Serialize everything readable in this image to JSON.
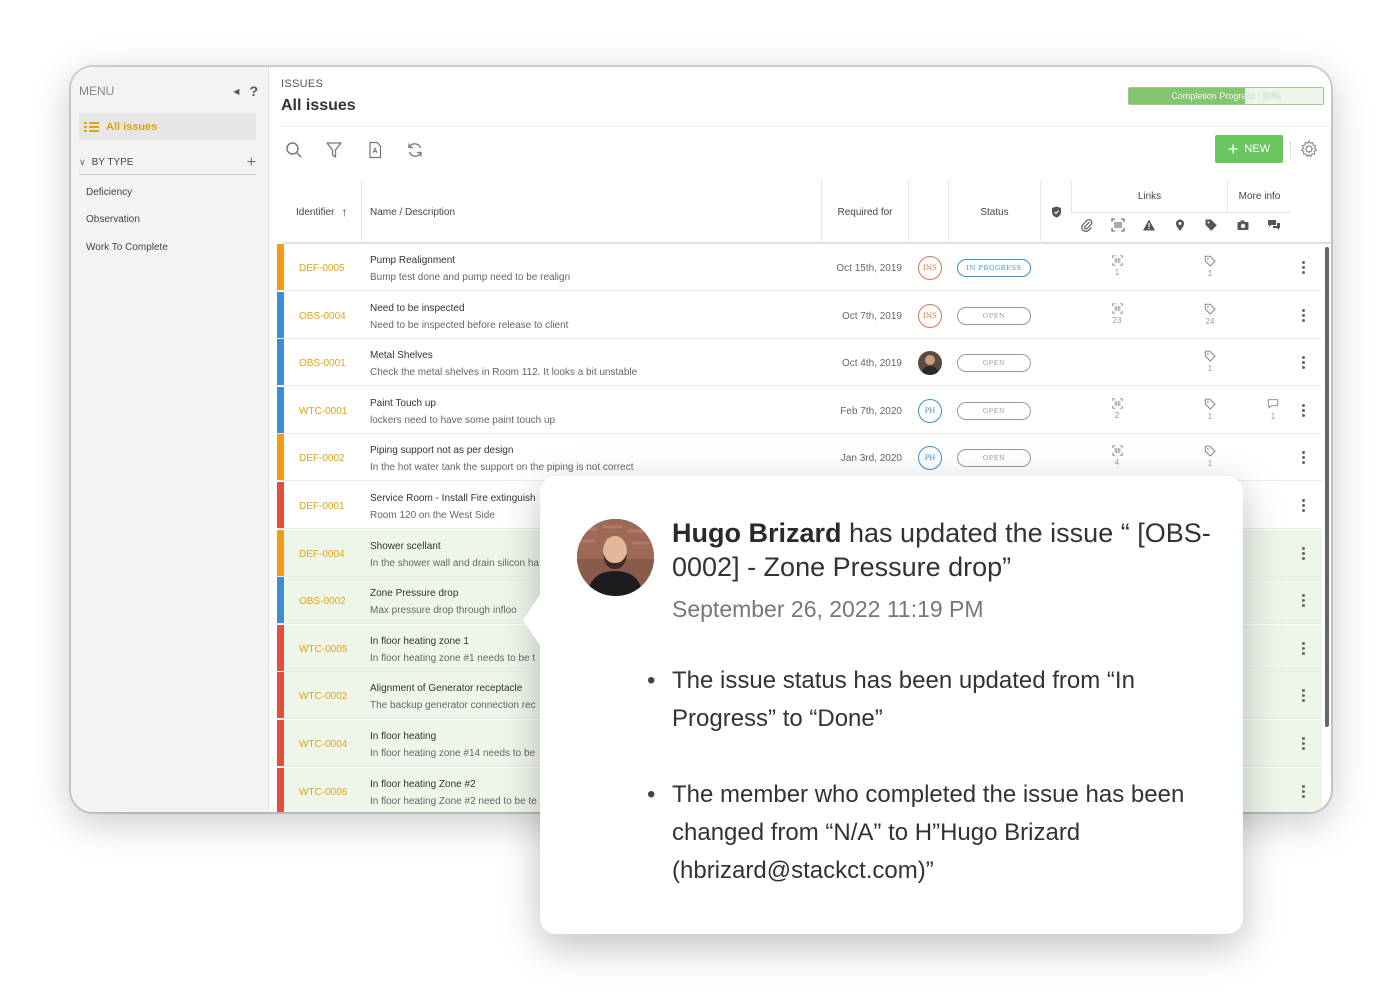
{
  "sidebar": {
    "menu_label": "MENU",
    "help": "?",
    "all_issues": "All issues",
    "by_type": "BY TYPE",
    "types": [
      "Deficiency",
      "Observation",
      "Work To Complete"
    ]
  },
  "header": {
    "crumb": "ISSUES",
    "title": "All issues",
    "progress_label": "Completion Progress : 60%",
    "progress_value": 0.6,
    "new_label": "NEW"
  },
  "table": {
    "col_identifier": "Identifier",
    "col_name": "Name / Description",
    "col_required": "Required for",
    "col_status": "Status",
    "col_links": "Links",
    "col_more": "More info",
    "rows": [
      {
        "id": "DEF-0005",
        "name": "Pump Realignment",
        "desc": "Bump test done and pump need to be realign",
        "req": "Oct 15th, 2019",
        "badge": "INS",
        "status": "IN PROGRESS",
        "color": "#f39c12",
        "l_scan": "1",
        "l_tag": "1",
        "l_chat": ""
      },
      {
        "id": "OBS-0004",
        "name": "Need to be inspected",
        "desc": "Need to be inspected before release to client",
        "req": "Oct 7th, 2019",
        "badge": "INS",
        "status": "OPEN",
        "color": "#3a8fd8",
        "l_scan": "23",
        "l_tag": "24",
        "l_chat": ""
      },
      {
        "id": "OBS-0001",
        "name": "Metal Shelves",
        "desc": "Check the metal shelves in Room 112. It looks a bit unstable",
        "req": "Oct 4th, 2019",
        "badge": "",
        "status": "OPEN",
        "color": "#3a8fd8",
        "l_scan": "",
        "l_tag": "1",
        "l_chat": ""
      },
      {
        "id": "WTC-0001",
        "name": "Paint Touch up",
        "desc": "lockers need to have some paint touch up",
        "req": "Feb 7th, 2020",
        "badge": "PH",
        "status": "OPEN",
        "color": "#3a8fd8",
        "l_scan": "2",
        "l_tag": "1",
        "l_chat": "1"
      },
      {
        "id": "DEF-0002",
        "name": "Piping support not as per design",
        "desc": "In the hot water tank the support on the piping is not correct",
        "req": "Jan 3rd, 2020",
        "badge": "PH",
        "status": "OPEN",
        "color": "#f39c12",
        "l_scan": "4",
        "l_tag": "1",
        "l_chat": ""
      },
      {
        "id": "DEF-0001",
        "name": "Service Room - Install Fire extinguish",
        "desc": "Room 120 on the West Side",
        "req": "",
        "badge": "",
        "status": "",
        "color": "#e74c3c",
        "l_scan": "",
        "l_tag": "",
        "l_chat": ""
      },
      {
        "id": "DEF-0004",
        "name": "Shower scellant",
        "desc": "In the shower wall and drain silicon ha",
        "req": "",
        "badge": "",
        "status": "",
        "color": "#f39c12",
        "l_scan": "",
        "l_tag": "",
        "l_chat": ""
      },
      {
        "id": "OBS-0002",
        "name": "Zone Pressure drop",
        "desc": "Max pressure drop through infloo",
        "req": "",
        "badge": "",
        "status": "",
        "color": "#3a8fd8",
        "l_scan": "",
        "l_tag": "",
        "l_chat": ""
      },
      {
        "id": "WTC-0005",
        "name": "In floor heating zone 1",
        "desc": "In floor heating zone #1 needs to be t",
        "req": "",
        "badge": "",
        "status": "",
        "color": "#e74c3c",
        "l_scan": "",
        "l_tag": "",
        "l_chat": ""
      },
      {
        "id": "WTC-0002",
        "name": "Alignment of Generator receptacle",
        "desc": "The backup generator connection rec",
        "req": "",
        "badge": "",
        "status": "",
        "color": "#e74c3c",
        "l_scan": "",
        "l_tag": "",
        "l_chat": ""
      },
      {
        "id": "WTC-0004",
        "name": "In floor heating",
        "desc": "In floor heating zone #14 needs to be",
        "req": "",
        "badge": "",
        "status": "",
        "color": "#e74c3c",
        "l_scan": "",
        "l_tag": "",
        "l_chat": ""
      },
      {
        "id": "WTC-0006",
        "name": "In floor heating Zone #2",
        "desc": "In floor heating Zone #2 need to be te",
        "req": "",
        "badge": "",
        "status": "",
        "color": "#e74c3c",
        "l_scan": "",
        "l_tag": "",
        "l_chat": ""
      }
    ]
  },
  "notification": {
    "user": "Hugo Brizard",
    "action": " has updated the issue “ [OBS-0002] - Zone Pressure drop”",
    "date": "September 26, 2022 11:19 PM",
    "items": [
      "The issue status has been updated from “In Progress” to “Done”",
      "The member who completed the issue has been changed from “N/A” to H”Hugo Brizard (hbrizard@stackct.com)”"
    ]
  }
}
